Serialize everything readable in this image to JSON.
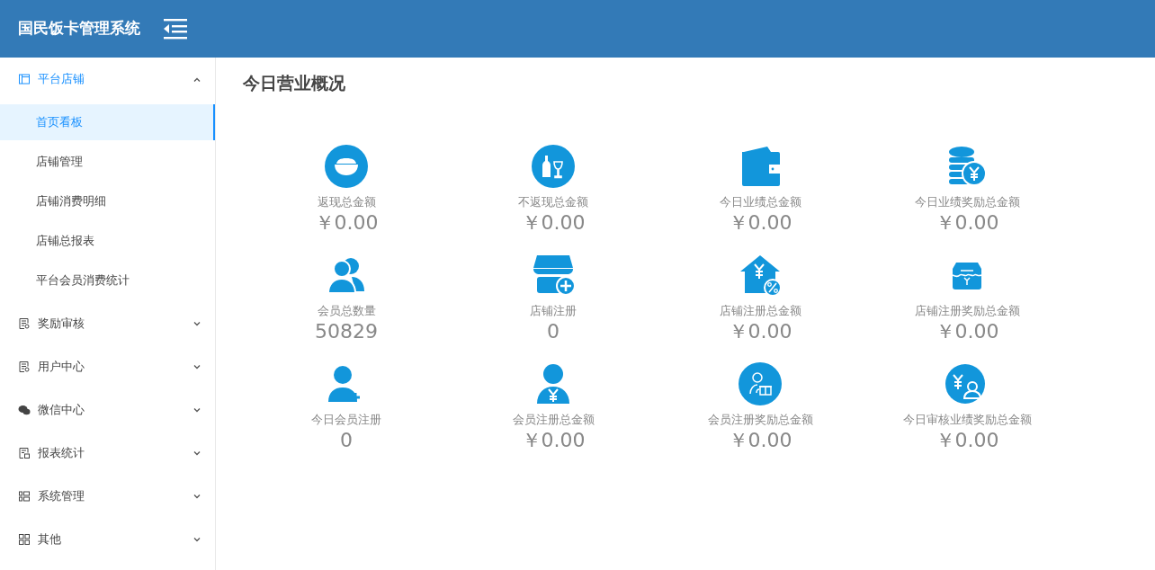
{
  "header": {
    "title": "国民饭卡管理系统"
  },
  "sidebar": {
    "groups": [
      {
        "label": "平台店铺",
        "expanded": true,
        "children": [
          {
            "label": "首页看板",
            "selected": true
          },
          {
            "label": "店铺管理",
            "selected": false
          },
          {
            "label": "店铺消费明细",
            "selected": false
          },
          {
            "label": "店铺总报表",
            "selected": false
          },
          {
            "label": "平台会员消费统计",
            "selected": false
          }
        ]
      },
      {
        "label": "奖励审核",
        "expanded": false
      },
      {
        "label": "用户中心",
        "expanded": false
      },
      {
        "label": "微信中心",
        "expanded": false
      },
      {
        "label": "报表统计",
        "expanded": false
      },
      {
        "label": "系统管理",
        "expanded": false
      },
      {
        "label": "其他",
        "expanded": false
      }
    ]
  },
  "main": {
    "title": "今日营业概况",
    "stats": [
      {
        "label": "返现总金额",
        "value": "￥0.00"
      },
      {
        "label": "不返现总金额",
        "value": "￥0.00"
      },
      {
        "label": "今日业绩总金额",
        "value": "￥0.00"
      },
      {
        "label": "今日业绩奖励总金额",
        "value": "￥0.00"
      },
      {
        "label": "会员总数量",
        "value": "50829"
      },
      {
        "label": "店铺注册",
        "value": "0"
      },
      {
        "label": "店铺注册总金额",
        "value": "￥0.00"
      },
      {
        "label": "店铺注册奖励总金额",
        "value": "￥0.00"
      },
      {
        "label": "今日会员注册",
        "value": "0"
      },
      {
        "label": "会员注册总金额",
        "value": "￥0.00"
      },
      {
        "label": "会员注册奖励总金额",
        "value": "￥0.00"
      },
      {
        "label": "今日审核业绩奖励总金额",
        "value": "￥0.00"
      }
    ]
  }
}
